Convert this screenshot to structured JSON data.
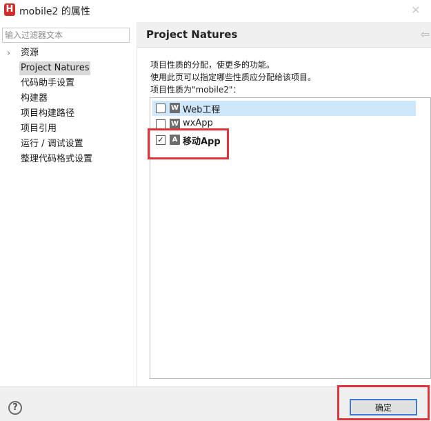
{
  "window": {
    "title": "mobile2 的属性"
  },
  "filter": {
    "placeholder": "输入过滤器文本",
    "value": ""
  },
  "sidebar": {
    "items": [
      {
        "label": "资源"
      },
      {
        "label": "Project Natures"
      },
      {
        "label": "代码助手设置"
      },
      {
        "label": "构建器"
      },
      {
        "label": "项目构建路径"
      },
      {
        "label": "项目引用"
      },
      {
        "label": "运行 / 调试设置"
      },
      {
        "label": "整理代码格式设置"
      }
    ],
    "selected": "Project Natures"
  },
  "page": {
    "title": "Project Natures",
    "description_lines": [
      "项目性质的分配，使更多的功能。",
      "使用此页可以指定哪些性质应分配给该项目。",
      "项目性质为\"mobile2\"："
    ]
  },
  "natures": [
    {
      "label": "Web工程",
      "checked": false,
      "icon": "web-project-icon",
      "icon_letter": "W"
    },
    {
      "label": "wxApp",
      "checked": false,
      "icon": "wxapp-icon",
      "icon_letter": "W"
    },
    {
      "label": "移动App",
      "checked": true,
      "icon": "mobile-app-icon",
      "icon_letter": "A"
    }
  ],
  "footer": {
    "help_glyph": "?",
    "ok_label": "确定"
  },
  "colors": {
    "highlight_box": "#e0343c",
    "selection": "#cfe7fb",
    "app_icon": "#d42b2b"
  }
}
